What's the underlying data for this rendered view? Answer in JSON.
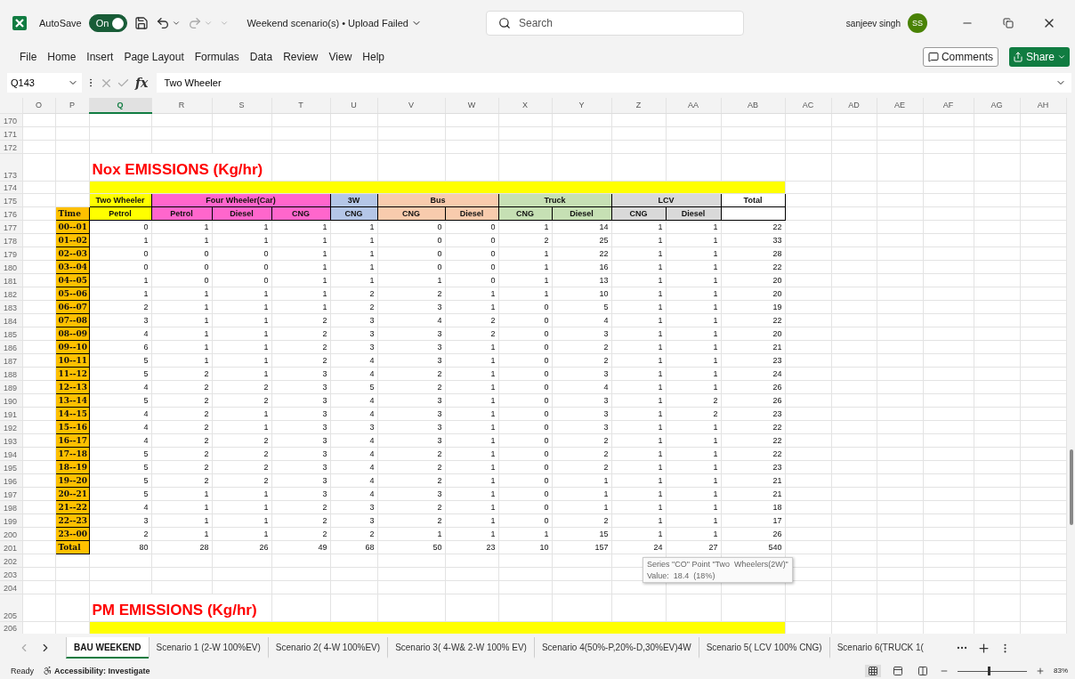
{
  "title_bar": {
    "autosave": {
      "label": "AutoSave",
      "on": true,
      "state_label": "On"
    },
    "document_title": "Weekend scenario(s) • Upload Failed",
    "search": {
      "placeholder": "Search"
    },
    "user": {
      "name": "sanjeev singh",
      "initials": "SS"
    }
  },
  "menu": {
    "items": [
      "File",
      "Home",
      "Insert",
      "Page Layout",
      "Formulas",
      "Data",
      "Review",
      "View",
      "Help"
    ],
    "comments": "Comments",
    "share": "Share"
  },
  "formula_bar": {
    "name_box": "Q143",
    "fx": "fx",
    "value": "Two Wheeler"
  },
  "sheet": {
    "columns": [
      {
        "label": "O",
        "selected": false
      },
      {
        "label": "P",
        "selected": false
      },
      {
        "label": "Q",
        "selected": true
      },
      {
        "label": "R",
        "selected": false
      },
      {
        "label": "S",
        "selected": false
      },
      {
        "label": "T",
        "selected": false
      },
      {
        "label": "U",
        "selected": false
      },
      {
        "label": "V",
        "selected": false
      },
      {
        "label": "W",
        "selected": false
      },
      {
        "label": "X",
        "selected": false
      },
      {
        "label": "Y",
        "selected": false
      },
      {
        "label": "Z",
        "selected": false
      },
      {
        "label": "AA",
        "selected": false
      },
      {
        "label": "AB",
        "selected": false
      },
      {
        "label": "AC",
        "selected": false
      },
      {
        "label": "AD",
        "selected": false
      },
      {
        "label": "AE",
        "selected": false
      },
      {
        "label": "AF",
        "selected": false
      },
      {
        "label": "AG",
        "selected": false
      },
      {
        "label": "AH",
        "selected": false
      }
    ],
    "rows": [
      {
        "kind": "blank",
        "number": "170"
      },
      {
        "kind": "blank",
        "number": "171"
      },
      {
        "kind": "blank",
        "number": "172"
      },
      {
        "kind": "title",
        "number": "173",
        "text": "Nox EMISSIONS (Kg/hr)"
      },
      {
        "kind": "band",
        "number": "174"
      },
      {
        "kind": "header",
        "numbers": [
          "175",
          "176"
        ],
        "time_label": "Time",
        "groups": [
          {
            "label": "Two Wheeler",
            "color": "#ffff00",
            "subs": [
              "Petrol"
            ]
          },
          {
            "label": "Four Wheeler(Car)",
            "color": "#ff66cc",
            "subs": [
              "Petrol",
              "Diesel",
              "CNG"
            ]
          },
          {
            "label": "3W",
            "color": "#b4c6e7",
            "subs": [
              "CNG"
            ]
          },
          {
            "label": "Bus",
            "color": "#f8cbad",
            "subs": [
              "CNG",
              "Diesel"
            ]
          },
          {
            "label": "Truck",
            "color": "#c6e0b4",
            "subs": [
              "CNG",
              "Diesel"
            ]
          },
          {
            "label": "LCV",
            "color": "#d9d9d9",
            "subs": [
              "CNG",
              "Diesel"
            ]
          },
          {
            "label": "Total",
            "color": "#ffffff"
          }
        ]
      },
      {
        "kind": "data",
        "number": "177",
        "time": "00--01",
        "values": [
          "0",
          "1",
          "1",
          "1",
          "1",
          "0",
          "0",
          "1",
          "14",
          "1",
          "1",
          "22"
        ]
      },
      {
        "kind": "data",
        "number": "178",
        "time": "01--02",
        "values": [
          "1",
          "1",
          "1",
          "1",
          "1",
          "0",
          "0",
          "2",
          "25",
          "1",
          "1",
          "33"
        ]
      },
      {
        "kind": "data",
        "number": "179",
        "time": "02--03",
        "values": [
          "0",
          "0",
          "0",
          "1",
          "1",
          "0",
          "0",
          "1",
          "22",
          "1",
          "1",
          "28"
        ]
      },
      {
        "kind": "data",
        "number": "180",
        "time": "03--04",
        "values": [
          "0",
          "0",
          "0",
          "1",
          "1",
          "0",
          "0",
          "1",
          "16",
          "1",
          "1",
          "22"
        ]
      },
      {
        "kind": "data",
        "number": "181",
        "time": "04--05",
        "values": [
          "1",
          "0",
          "0",
          "1",
          "1",
          "1",
          "0",
          "1",
          "13",
          "1",
          "1",
          "20"
        ]
      },
      {
        "kind": "data",
        "number": "182",
        "time": "05--06",
        "values": [
          "1",
          "1",
          "1",
          "1",
          "2",
          "2",
          "1",
          "1",
          "10",
          "1",
          "1",
          "20"
        ]
      },
      {
        "kind": "data",
        "number": "183",
        "time": "06--07",
        "values": [
          "2",
          "1",
          "1",
          "1",
          "2",
          "3",
          "1",
          "0",
          "5",
          "1",
          "1",
          "19"
        ]
      },
      {
        "kind": "data",
        "number": "184",
        "time": "07--08",
        "values": [
          "3",
          "1",
          "1",
          "2",
          "3",
          "4",
          "2",
          "0",
          "4",
          "1",
          "1",
          "22"
        ]
      },
      {
        "kind": "data",
        "number": "185",
        "time": "08--09",
        "values": [
          "4",
          "1",
          "1",
          "2",
          "3",
          "3",
          "2",
          "0",
          "3",
          "1",
          "1",
          "20"
        ]
      },
      {
        "kind": "data",
        "number": "186",
        "time": "09--10",
        "values": [
          "6",
          "1",
          "1",
          "2",
          "3",
          "3",
          "1",
          "0",
          "2",
          "1",
          "1",
          "21"
        ]
      },
      {
        "kind": "data",
        "number": "187",
        "time": "10--11",
        "values": [
          "5",
          "1",
          "1",
          "2",
          "4",
          "3",
          "1",
          "0",
          "2",
          "1",
          "1",
          "23"
        ]
      },
      {
        "kind": "data",
        "number": "188",
        "time": "11--12",
        "values": [
          "5",
          "2",
          "1",
          "3",
          "4",
          "2",
          "1",
          "0",
          "3",
          "1",
          "1",
          "24"
        ]
      },
      {
        "kind": "data",
        "number": "189",
        "time": "12--13",
        "values": [
          "4",
          "2",
          "2",
          "3",
          "5",
          "2",
          "1",
          "0",
          "4",
          "1",
          "1",
          "26"
        ]
      },
      {
        "kind": "data",
        "number": "190",
        "time": "13--14",
        "values": [
          "5",
          "2",
          "2",
          "3",
          "4",
          "3",
          "1",
          "0",
          "3",
          "1",
          "2",
          "26"
        ]
      },
      {
        "kind": "data",
        "number": "191",
        "time": "14--15",
        "values": [
          "4",
          "2",
          "1",
          "3",
          "4",
          "3",
          "1",
          "0",
          "3",
          "1",
          "2",
          "23"
        ]
      },
      {
        "kind": "data",
        "number": "192",
        "time": "15--16",
        "values": [
          "4",
          "2",
          "1",
          "3",
          "3",
          "3",
          "1",
          "0",
          "3",
          "1",
          "1",
          "22"
        ]
      },
      {
        "kind": "data",
        "number": "193",
        "time": "16--17",
        "values": [
          "4",
          "2",
          "2",
          "3",
          "4",
          "3",
          "1",
          "0",
          "2",
          "1",
          "1",
          "22"
        ]
      },
      {
        "kind": "data",
        "number": "194",
        "time": "17--18",
        "values": [
          "5",
          "2",
          "2",
          "3",
          "4",
          "2",
          "1",
          "0",
          "2",
          "1",
          "1",
          "22"
        ]
      },
      {
        "kind": "data",
        "number": "195",
        "time": "18--19",
        "values": [
          "5",
          "2",
          "2",
          "3",
          "4",
          "2",
          "1",
          "0",
          "2",
          "1",
          "1",
          "23"
        ]
      },
      {
        "kind": "data",
        "number": "196",
        "time": "19--20",
        "values": [
          "5",
          "2",
          "2",
          "3",
          "4",
          "2",
          "1",
          "0",
          "1",
          "1",
          "1",
          "21"
        ]
      },
      {
        "kind": "data",
        "number": "197",
        "time": "20--21",
        "values": [
          "5",
          "1",
          "1",
          "3",
          "4",
          "3",
          "1",
          "0",
          "1",
          "1",
          "1",
          "21"
        ]
      },
      {
        "kind": "data",
        "number": "198",
        "time": "21--22",
        "values": [
          "4",
          "1",
          "1",
          "2",
          "3",
          "2",
          "1",
          "0",
          "1",
          "1",
          "1",
          "18"
        ]
      },
      {
        "kind": "data",
        "number": "199",
        "time": "22--23",
        "values": [
          "3",
          "1",
          "1",
          "2",
          "3",
          "2",
          "1",
          "0",
          "2",
          "1",
          "1",
          "17"
        ]
      },
      {
        "kind": "data",
        "number": "200",
        "time": "23--00",
        "values": [
          "2",
          "1",
          "1",
          "2",
          "2",
          "1",
          "1",
          "1",
          "15",
          "1",
          "1",
          "26"
        ]
      },
      {
        "kind": "data",
        "number": "201",
        "time": "Total",
        "values": [
          "80",
          "28",
          "26",
          "49",
          "68",
          "50",
          "23",
          "10",
          "157",
          "24",
          "27",
          "540"
        ]
      },
      {
        "kind": "blank",
        "number": "202"
      },
      {
        "kind": "blank",
        "number": "203"
      },
      {
        "kind": "blank",
        "number": "204"
      },
      {
        "kind": "title",
        "number": "205",
        "text": "PM EMISSIONS (Kg/hr)"
      },
      {
        "kind": "band",
        "number": "206"
      }
    ],
    "tooltip": {
      "lines": [
        "Series \"CO\" Point \"Two  Wheelers(2W)\"",
        "Value:  18.4  (18%)"
      ]
    }
  },
  "sheet_tabs": {
    "tabs": [
      {
        "label": "BAU WEEKEND",
        "selected": true
      },
      {
        "label": "Scenario 1 (2-W 100%EV)",
        "selected": false
      },
      {
        "label": "Scenario 2( 4-W 100%EV)",
        "selected": false
      },
      {
        "label": "Scenario 3( 4-W& 2-W 100% EV)",
        "selected": false
      },
      {
        "label": "Scenario 4(50%-P,20%-D,30%EV)4W",
        "selected": false
      },
      {
        "label": "Scenario 5( LCV 100% CNG)",
        "selected": false
      },
      {
        "label": "Scenario 6(TRUCK 1(",
        "selected": false
      }
    ]
  },
  "status_bar": {
    "status": "Ready",
    "accessibility": "Accessibility: Investigate",
    "zoom": {
      "level": 0.45,
      "reading": "83%"
    }
  }
}
